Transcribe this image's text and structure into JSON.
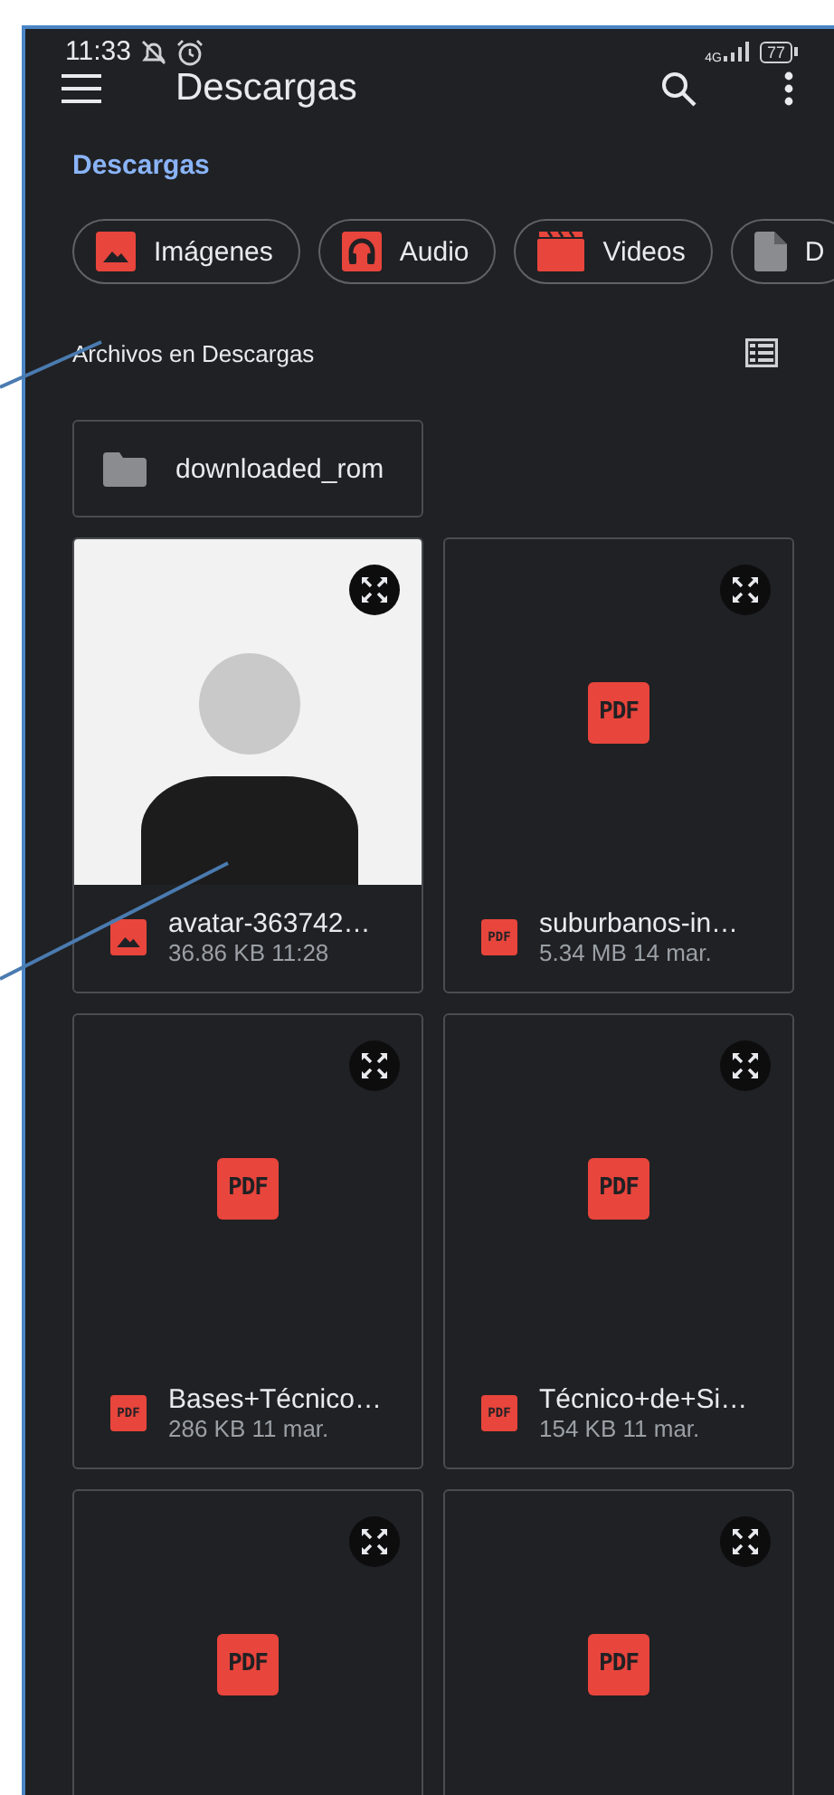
{
  "status_bar": {
    "time": "11:33",
    "network": "4G",
    "battery": "77"
  },
  "app_bar": {
    "title": "Descargas"
  },
  "breadcrumb": "Descargas",
  "chips": [
    {
      "kind": "images",
      "label": "Imágenes"
    },
    {
      "kind": "audio",
      "label": "Audio"
    },
    {
      "kind": "videos",
      "label": "Videos"
    },
    {
      "kind": "documents",
      "label": "D"
    }
  ],
  "section": {
    "title": "Archivos en Descargas"
  },
  "folders": [
    {
      "name": "downloaded_rom"
    }
  ],
  "files": [
    {
      "kind": "image",
      "name": "avatar-363742…",
      "meta": "36.86 KB 11:28"
    },
    {
      "kind": "pdf",
      "thumb_badge": "PDF",
      "icon_badge": "PDF",
      "name": "suburbanos-in…",
      "meta": "5.34 MB 14 mar."
    },
    {
      "kind": "pdf",
      "thumb_badge": "PDF",
      "icon_badge": "PDF",
      "name": "Bases+Técnico…",
      "meta": "286 KB 11 mar."
    },
    {
      "kind": "pdf",
      "thumb_badge": "PDF",
      "icon_badge": "PDF",
      "name": "Técnico+de+Si…",
      "meta": "154 KB 11 mar."
    },
    {
      "kind": "pdf",
      "thumb_badge": "PDF"
    },
    {
      "kind": "pdf",
      "thumb_badge": "PDF"
    }
  ]
}
